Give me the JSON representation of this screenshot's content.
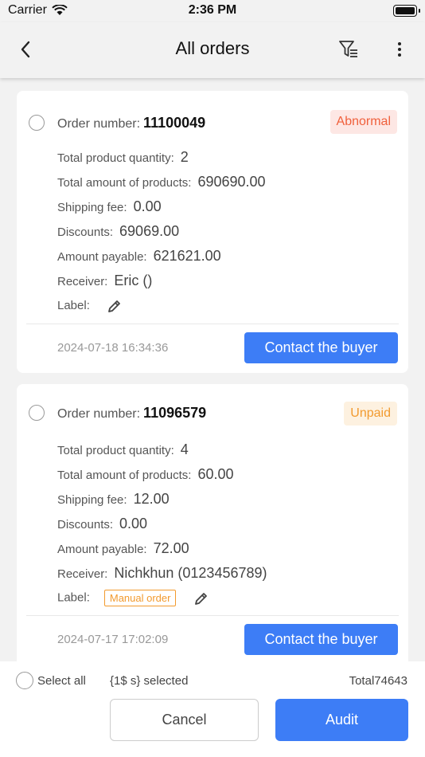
{
  "status_bar": {
    "carrier": "Carrier",
    "time": "2:36 PM"
  },
  "header": {
    "title": "All orders"
  },
  "orders": [
    {
      "order_number_label": "Order number:",
      "order_number": "11100049",
      "status": "Abnormal",
      "total_qty_label": "Total product quantity:",
      "total_qty": "2",
      "total_amount_label": "Total amount of products:",
      "total_amount": "690690.00",
      "shipping_label": "Shipping fee:",
      "shipping": "0.00",
      "discounts_label": "Discounts:",
      "discounts": "69069.00",
      "payable_label": "Amount payable:",
      "payable": "621621.00",
      "receiver_label": "Receiver:",
      "receiver": "Eric ()",
      "label_label": "Label:",
      "date": "2024-07-18 16:34:36",
      "contact_label": "Contact the buyer"
    },
    {
      "order_number_label": "Order number:",
      "order_number": "11096579",
      "status": "Unpaid",
      "total_qty_label": "Total product quantity:",
      "total_qty": "4",
      "total_amount_label": "Total amount of products:",
      "total_amount": "60.00",
      "shipping_label": "Shipping fee:",
      "shipping": "12.00",
      "discounts_label": "Discounts:",
      "discounts": "0.00",
      "payable_label": "Amount payable:",
      "payable": "72.00",
      "receiver_label": "Receiver:",
      "receiver": "Nichkhun (0123456789)",
      "label_label": "Label:",
      "tag": "Manual order",
      "date": "2024-07-17 17:02:09",
      "contact_label": "Contact the buyer"
    }
  ],
  "bottom_bar": {
    "select_all": "Select all",
    "selected_text": "{1$ s} selected",
    "total": "Total74643",
    "cancel_label": "Cancel",
    "audit_label": "Audit"
  },
  "colors": {
    "accent": "#3d7df6",
    "abnormal": "#f0603c",
    "unpaid": "#f29a2e"
  }
}
